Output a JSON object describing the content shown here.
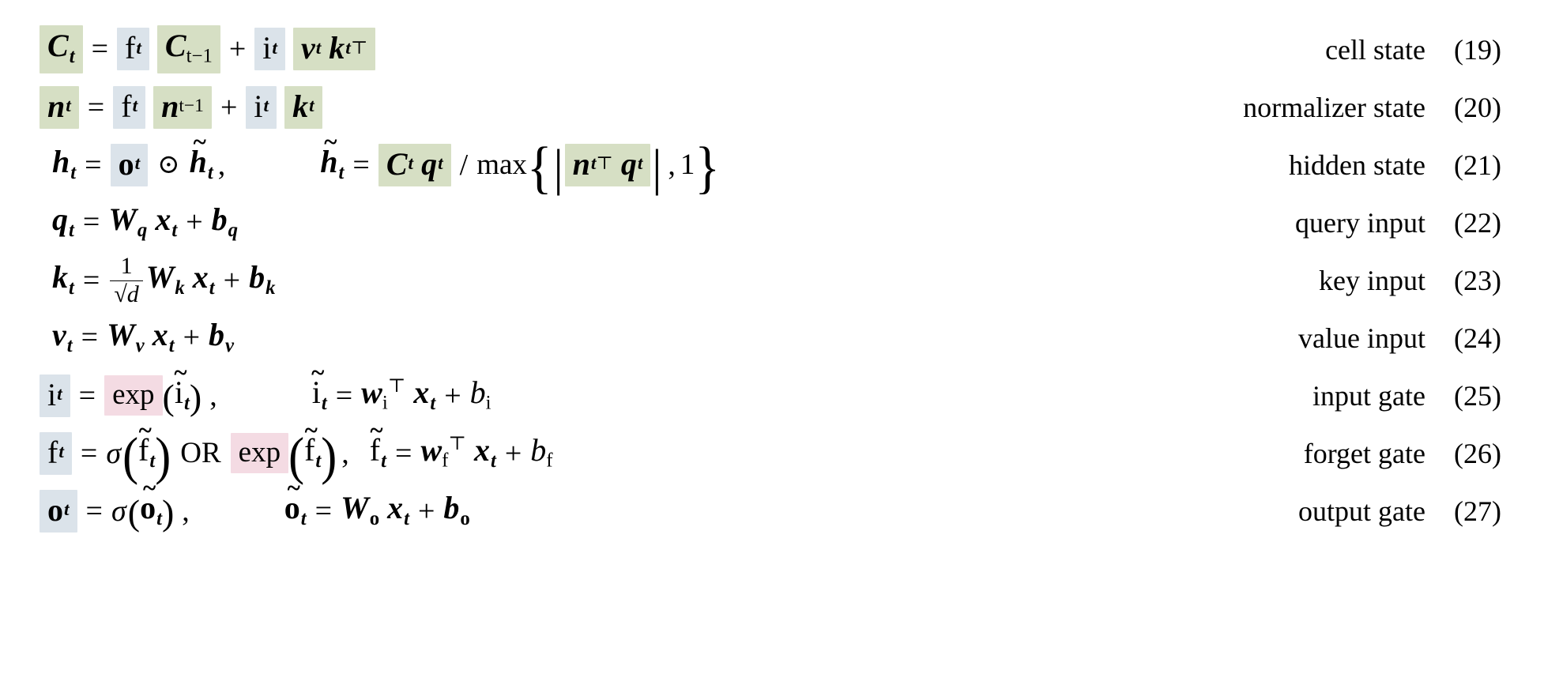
{
  "document": {
    "kind": "equation-block",
    "description": "mLSTM cell equations with highlighted memory, gate and exponential terms",
    "background": "#ffffff",
    "text_color": "#000000"
  },
  "highlight_colors": {
    "memory_green": "#d6dfc4",
    "gate_blue": "#dbe3ea",
    "exp_pink": "#f4dbe3"
  },
  "equations": [
    {
      "id": "cell-state",
      "number": "(19)",
      "label": "cell state",
      "plain": "C_t = f_t C_{t-1} + i_t v_t k_t^T",
      "lhs": "C_t",
      "tokens": [
        "C_t",
        "=",
        "f_t",
        "C_{t-1}",
        "+",
        "i_t",
        "v_t k_t^T"
      ]
    },
    {
      "id": "normalizer-state",
      "number": "(20)",
      "label": "normalizer state",
      "plain": "n_t = f_t n_{t-1} + i_t k_t",
      "lhs": "n_t",
      "tokens": [
        "n_t",
        "=",
        "f_t",
        "n_{t-1}",
        "+",
        "i_t",
        "k_t"
      ]
    },
    {
      "id": "hidden-state",
      "number": "(21)",
      "label": "hidden state",
      "plain": "h_t = o_t ⊙ h~_t , h~_t = C_t q_t / max{ |n_t^T q_t| , 1 }",
      "lhs": "h_t",
      "tokens": [
        "h_t",
        "=",
        "o_t",
        "⊙",
        "h~_t",
        ",",
        "h~_t",
        "=",
        "C_t q_t",
        "/",
        "max",
        "{",
        "|",
        "n_t^T q_t",
        "|",
        ",",
        "1",
        "}"
      ]
    },
    {
      "id": "query-input",
      "number": "(22)",
      "label": "query input",
      "plain": "q_t = W_q x_t + b_q",
      "lhs": "q_t",
      "tokens": [
        "q_t",
        "=",
        "W_q",
        "x_t",
        "+",
        "b_q"
      ]
    },
    {
      "id": "key-input",
      "number": "(23)",
      "label": "key input",
      "plain": "k_t = (1/sqrt(d)) W_k x_t + b_k",
      "lhs": "k_t",
      "fraction": {
        "numerator": "1",
        "denominator": "sqrt(d)",
        "denominator_radicand": "d"
      },
      "tokens": [
        "k_t",
        "=",
        "1/sqrt(d)",
        "W_k",
        "x_t",
        "+",
        "b_k"
      ]
    },
    {
      "id": "value-input",
      "number": "(24)",
      "label": "value input",
      "plain": "v_t = W_v x_t + b_v",
      "lhs": "v_t",
      "tokens": [
        "v_t",
        "=",
        "W_v",
        "x_t",
        "+",
        "b_v"
      ]
    },
    {
      "id": "input-gate",
      "number": "(25)",
      "label": "input gate",
      "plain": "i_t = exp(i~_t) , i~_t = w_i^T x_t + b_i",
      "lhs": "i_t",
      "tokens": [
        "i_t",
        "=",
        "exp",
        "(",
        "i~_t",
        ")",
        ",",
        "i~_t",
        "=",
        "w_i^T",
        "x_t",
        "+",
        "b_i"
      ]
    },
    {
      "id": "forget-gate",
      "number": "(26)",
      "label": "forget gate",
      "plain": "f_t = sigma(f~_t) OR exp(f~_t) , f~_t = w_f^T x_t + b_f",
      "lhs": "f_t",
      "tokens": [
        "f_t",
        "=",
        "σ",
        "(",
        "f~_t",
        ")",
        "OR",
        "exp",
        "(",
        "f~_t",
        ")",
        ",",
        "f~_t",
        "=",
        "w_f^T",
        "x_t",
        "+",
        "b_f"
      ]
    },
    {
      "id": "output-gate",
      "number": "(27)",
      "label": "output gate",
      "plain": "o_t = sigma(o~_t) , o~_t = W_o x_t + b_o",
      "lhs": "o_t",
      "tokens": [
        "o_t",
        "=",
        "σ",
        "(",
        "o~_t",
        ")",
        ",",
        "o~_t",
        "=",
        "W_o",
        "x_t",
        "+",
        "b_o"
      ]
    }
  ],
  "symbols": {
    "C": "C",
    "n": "n",
    "h": "h",
    "q": "q",
    "k": "k",
    "v": "v",
    "x": "x",
    "b": "b",
    "W": "W",
    "w": "w",
    "i": "i",
    "f": "f",
    "o": "o",
    "d": "d",
    "t": "t",
    "t_minus_1": "t−1",
    "one": "1",
    "equals": "=",
    "plus": "+",
    "slash": "/",
    "comma": ",",
    "transpose": "⊤",
    "tilde": "~",
    "odot": "⊙",
    "sigma": "σ",
    "max": "max",
    "exp": "exp",
    "or": "OR",
    "lparen": "(",
    "rparen": ")",
    "lbrace": "{",
    "rbrace": "}",
    "vbar": "|",
    "sqrt": "√"
  }
}
